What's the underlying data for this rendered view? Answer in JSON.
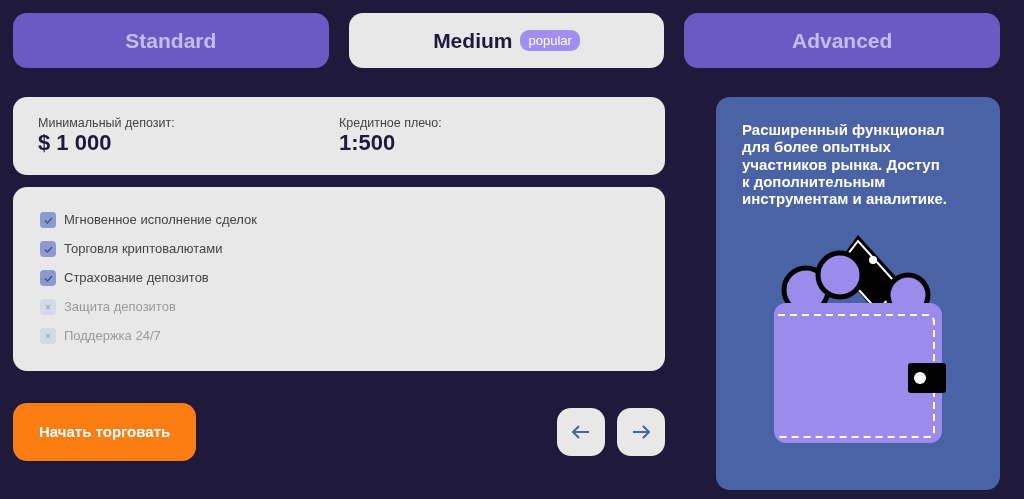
{
  "tabs": [
    {
      "label": "Standard",
      "selected": false
    },
    {
      "label": "Medium",
      "selected": true,
      "badge": "popular"
    },
    {
      "label": "Advanced",
      "selected": false
    }
  ],
  "stats": [
    {
      "label": "Минимальный депозит:",
      "value": "$ 1 000"
    },
    {
      "label": "Кредитное плечо:",
      "value": "1:500"
    }
  ],
  "features": [
    {
      "label": "Мгновенное исполнение сделок",
      "checked": true
    },
    {
      "label": "Торговля криптовалютами",
      "checked": true
    },
    {
      "label": "Страхование депозитов",
      "checked": true
    },
    {
      "label": "Защита депозитов",
      "checked": false
    },
    {
      "label": "Поддержка 24/7",
      "checked": false
    }
  ],
  "cta": "Начать торговать",
  "description": "Расширенный функционал для более опытных участников рынка. Доступ к дополнительным инструментам и аналитике."
}
